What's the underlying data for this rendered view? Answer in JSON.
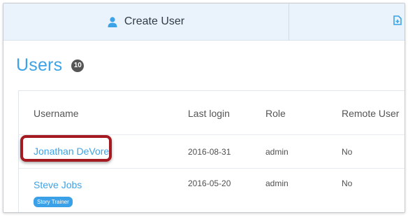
{
  "toolbar": {
    "create_user_label": "Create User"
  },
  "page": {
    "title": "Users",
    "count": "10"
  },
  "table": {
    "headers": [
      "Username",
      "Last login",
      "Role",
      "Remote User"
    ],
    "rows": [
      {
        "username": "Jonathan DeVore",
        "last_login": "2016-08-31",
        "role": "admin",
        "remote_user": "No",
        "tag": ""
      },
      {
        "username": "Steve Jobs",
        "last_login": "2016-05-20",
        "role": "admin",
        "remote_user": "No",
        "tag": "Story Trainer"
      }
    ]
  },
  "colors": {
    "accent": "#3ba3e6",
    "highlight": "#a51a21",
    "toolbar_bg": "#eaf3fb"
  }
}
